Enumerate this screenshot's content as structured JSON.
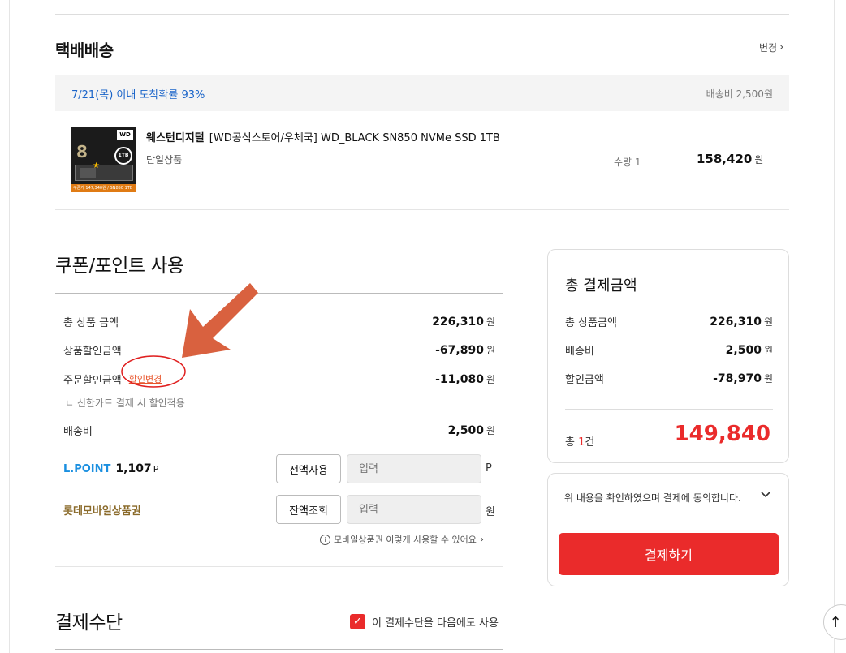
{
  "shipping": {
    "title": "택배배송",
    "change_label": "변경",
    "delivery_date": "7/21(목) 이내 도착확률 93%",
    "delivery_fee": "배송비 2,500원"
  },
  "product": {
    "brand": "웨스턴디지털",
    "name": "[WD공식스토어/우체국] WD_BLACK SN850 NVMe SSD 1TB",
    "option": "단일상품",
    "quantity": "수량 1",
    "price": "158,420",
    "price_unit": "원",
    "thumbnail": {
      "badge": "WD",
      "capacity": "1TB",
      "big_digit": "8",
      "price_strip": "쿠폰가 147,340원 / SN850 1TB"
    }
  },
  "coupon": {
    "title": "쿠폰/포인트 사용",
    "rows": [
      {
        "label": "총 상품 금액",
        "value": "226,310",
        "unit": "원"
      },
      {
        "label": "상품할인금액",
        "value": "-67,890",
        "unit": "원"
      },
      {
        "label": "주문할인금액",
        "value": "-11,080",
        "unit": "원",
        "link": "할인변경"
      },
      {
        "label": "배송비",
        "value": "2,500",
        "unit": "원"
      }
    ],
    "sub_note": "ㄴ 신한카드 결제 시 할인적용",
    "lpoint": {
      "label": "L.POINT",
      "value": "1,107",
      "value_unit": "P",
      "button": "전액사용",
      "placeholder": "입력",
      "unit": "P"
    },
    "mobile_voucher": {
      "label": "롯데모바일상품권",
      "button": "잔액조회",
      "placeholder": "입력",
      "unit": "원"
    },
    "mobile_help": "모바일상품권 이렇게 사용할 수 있어요"
  },
  "payment_method": {
    "title": "결제수단",
    "reuse_label": "이 결제수단을 다음에도 사용",
    "reuse_checked": true
  },
  "summary": {
    "title": "총 결제금액",
    "rows": [
      {
        "label": "총 상품금액",
        "value": "226,310",
        "unit": "원"
      },
      {
        "label": "배송비",
        "value": "2,500",
        "unit": "원"
      },
      {
        "label": "할인금액",
        "value": "-78,970",
        "unit": "원"
      }
    ],
    "total_prefix": "총",
    "total_count": "1",
    "total_suffix": "건",
    "total_amount": "149,840"
  },
  "agree": {
    "text": "위 내용을 확인하였으며 결제에 동의합니다.",
    "pay_button": "결제하기"
  },
  "colors": {
    "accent_red": "#ea2b2b",
    "link_blue": "#1a64c9",
    "lpoint_blue": "#1a8fe0",
    "voucher_gold": "#8a6a2a",
    "annotation_orange": "#d9613f"
  },
  "icons": {
    "change": "chevron-right-icon",
    "info": "info-icon",
    "agree_expand": "chevron-down-icon",
    "top": "arrow-up-icon",
    "check": "checkmark-icon"
  }
}
